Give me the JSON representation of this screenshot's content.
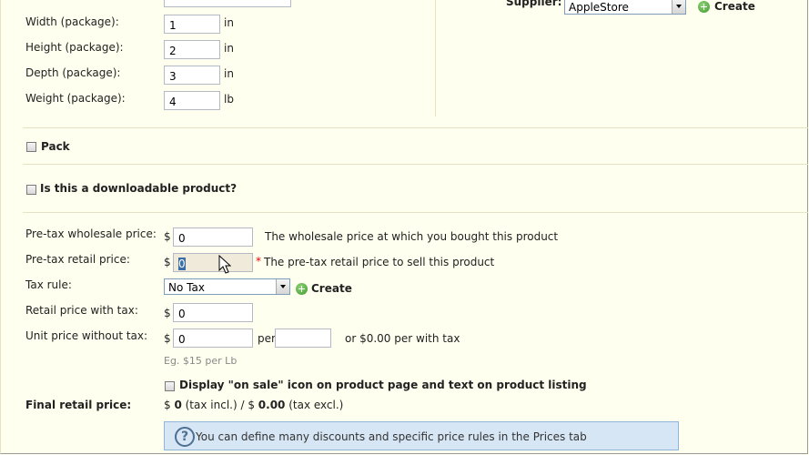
{
  "dimensions": {
    "width_label": "Width (package):",
    "width_value": "1",
    "width_unit": "in",
    "height_label": "Height (package):",
    "height_value": "2",
    "height_unit": "in",
    "depth_label": "Depth (package):",
    "depth_value": "3",
    "depth_unit": "in",
    "weight_label": "Weight (package):",
    "weight_value": "4",
    "weight_unit": "lb"
  },
  "supplier": {
    "label": "Supplier:",
    "selected": "AppleStore",
    "create_label": "Create"
  },
  "pack": {
    "label": "Pack"
  },
  "downloadable": {
    "label": "Is this a downloadable product?"
  },
  "pricing": {
    "currency": "$",
    "wholesale_label": "Pre-tax wholesale price:",
    "wholesale_value": "0",
    "wholesale_hint": "The wholesale price at which you bought this product",
    "retail_label": "Pre-tax retail price:",
    "retail_value": "0",
    "required_mark": "*",
    "retail_hint": "The pre-tax retail price to sell this product",
    "tax_label": "Tax rule:",
    "tax_selected": "No Tax",
    "tax_create_label": "Create",
    "retail_with_tax_label": "Retail price with tax:",
    "retail_with_tax_value": "0",
    "unit_label": "Unit price without tax:",
    "unit_value": "0",
    "unit_per": "per",
    "unit_unit_value": "",
    "unit_with_tax": "or $0.00 per with tax",
    "unit_example": "Eg. $15 per Lb",
    "on_sale_label": "Display \"on sale\" icon on product page and text on product listing",
    "final_label": "Final retail price:",
    "final_pre": "$ ",
    "final_incl_value": "0",
    "final_incl_text": " (tax incl.) / $ ",
    "final_excl_value": "0.00",
    "final_excl_text": " (tax excl.)"
  },
  "info": {
    "icon": "help-icon",
    "text": "You can define many discounts and specific price rules in the Prices tab"
  },
  "colors": {
    "background": "#fffff0",
    "info_bg": "#d6e6f5",
    "create_icon": "#3e9a2a"
  }
}
